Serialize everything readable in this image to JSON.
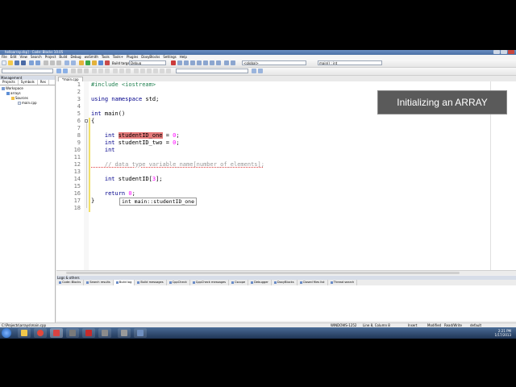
{
  "window": {
    "title": "helloarray.cbp] - Code::Blocks 10.05"
  },
  "menubar": [
    "File",
    "Edit",
    "View",
    "Search",
    "Project",
    "Build",
    "Debug",
    "wxSmith",
    "Tools",
    "Tools+",
    "Plugins",
    "DoxyBlocks",
    "Settings",
    "Help"
  ],
  "toolbar": {
    "build_target": "Build target:",
    "target_value": "Debug",
    "scope_value": "<global>",
    "symbol_value": "main() : int"
  },
  "management": {
    "title": "Management",
    "tabs": [
      "Projects",
      "Symbols",
      "Res"
    ],
    "tree": {
      "workspace": "Workspace",
      "project": "arrays",
      "folder": "Sources",
      "file": "main.cpp"
    }
  },
  "editor": {
    "file_tab": "*main.cpp",
    "line_numbers": [
      "1",
      "2",
      "3",
      "4",
      "5",
      "6",
      "7",
      "8",
      "9",
      "10",
      "11",
      "12",
      "13",
      "14",
      "15",
      "16",
      "17",
      "18"
    ],
    "lines": {
      "l1_include": "#include",
      "l1_header": " <iostream>",
      "l3_using": "using",
      "l3_namespace": " namespace",
      "l3_std": " std;",
      "l5_int": "int",
      "l5_main": " main()",
      "l6_brace": "{",
      "l8_int": "    int ",
      "l8_ident": "studentID_one",
      "l8_assign": " = ",
      "l8_value": "0",
      "l8_semicolon": ";",
      "l9_int": "    int ",
      "l9_ident": "studentID_two",
      "l9_assign": " = ",
      "l9_value": "0",
      "l9_semicolon": ";",
      "l10_int": "    int ",
      "l12_comment": "    // data_type variable_name[number_of_elements];",
      "l14_int": "    int",
      "l14_decl": " studentID[",
      "l14_size": "3",
      "l14_end": "];",
      "l16_return": "    return",
      "l16_space": " ",
      "l16_value": "0",
      "l16_semicolon": ";",
      "l17_brace": "}"
    },
    "tooltip": "int main::studentID_one"
  },
  "caption": "Initializing an ARRAY",
  "logs": {
    "title": "Logs & others",
    "tabs": [
      "Code::Blocks",
      "Search results",
      "Build log",
      "Build messages",
      "CppCheck",
      "CppCheck messages",
      "Cscope",
      "Debugger",
      "DoxyBlocks",
      "Closed files list",
      "Thread search"
    ]
  },
  "statusbar": {
    "path": "C:\\Projects\\arrays\\main.cpp",
    "line_ending": "WINDOWS-1252",
    "position": "Line 8, Column 8",
    "insert": "Insert",
    "modified": "Modified",
    "rw": "Read/Write",
    "profile": "default"
  },
  "taskbar": {
    "time": "2:21 PM",
    "date": "1/17/2013"
  },
  "colors": {
    "selection": "#e67b7b",
    "keyword": "#00008b",
    "number": "#ff00ff",
    "preprocessor": "#208050"
  }
}
